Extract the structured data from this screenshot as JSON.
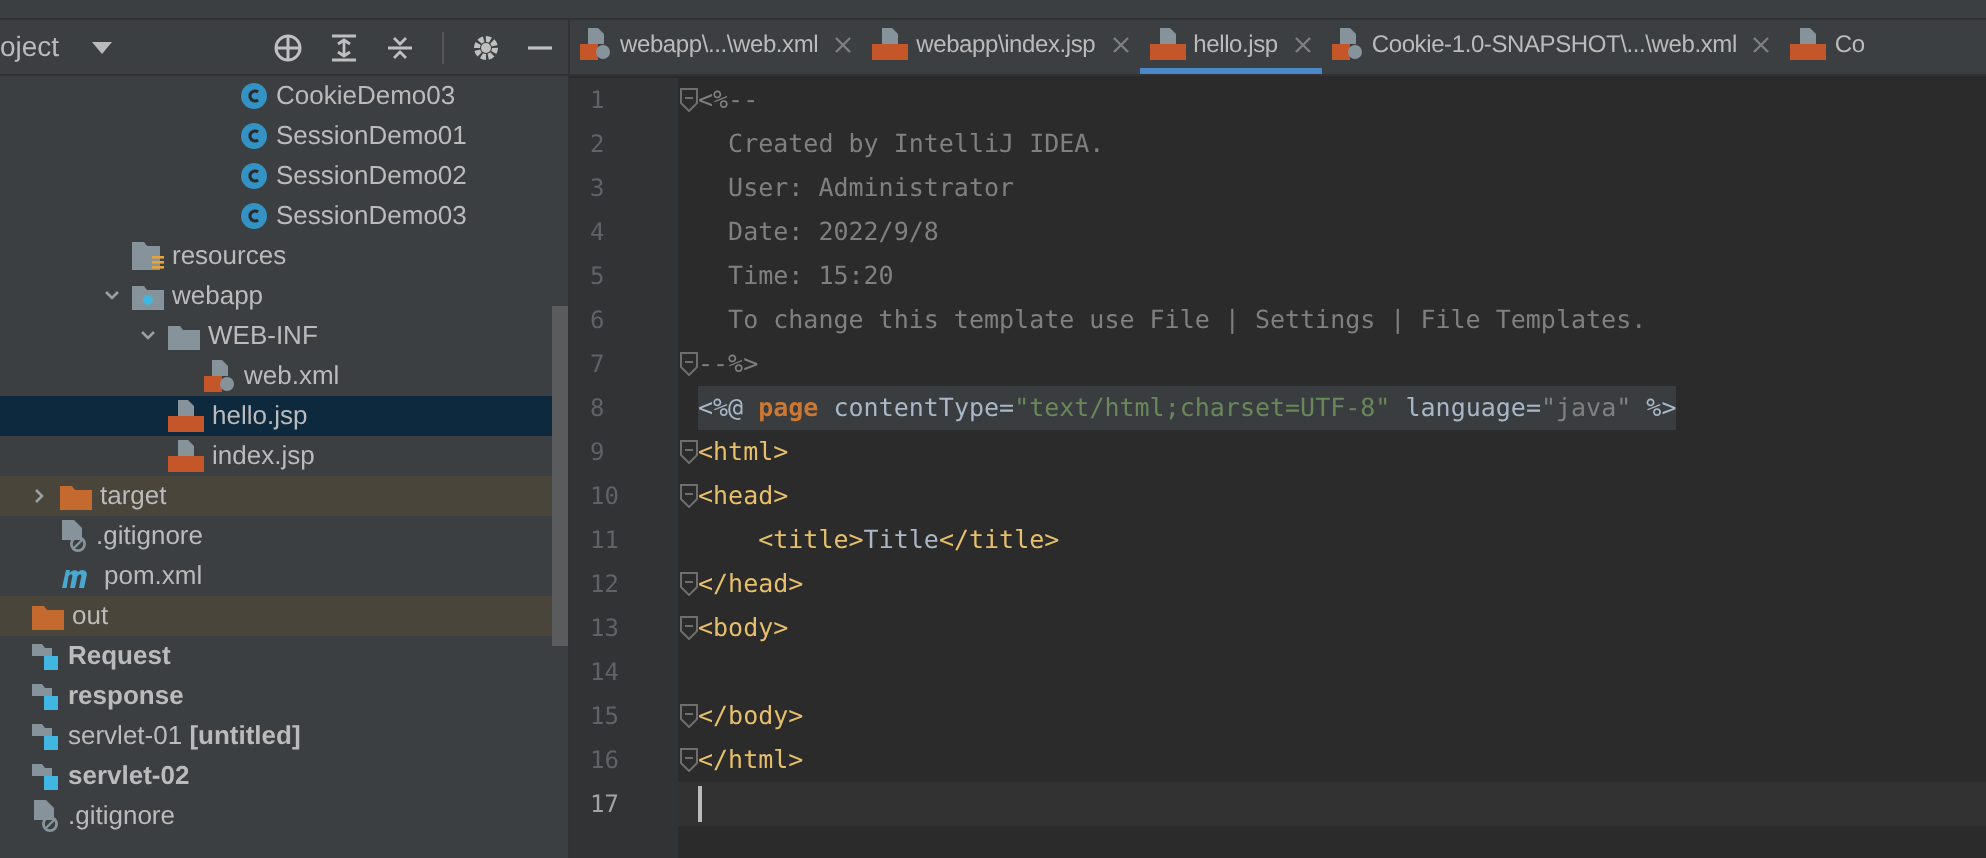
{
  "project_panel": {
    "title": "oject",
    "tree": [
      [
        {
          "name": "CookieDemo03",
          "kind": "class"
        },
        {
          "name": "SessionDemo01",
          "kind": "class"
        },
        {
          "name": "SessionDemo02",
          "kind": "class"
        },
        {
          "name": "SessionDemo03",
          "kind": "class"
        }
      ],
      [
        {
          "name": "resources",
          "kind": "resources-folder"
        },
        {
          "name": "webapp",
          "kind": "web-folder",
          "expanded": true,
          "children": [
            {
              "name": "WEB-INF",
              "kind": "folder",
              "expanded": true,
              "children": [
                {
                  "name": "web.xml",
                  "kind": "xml",
                  "selected": false
                }
              ]
            },
            {
              "name": "hello.jsp",
              "kind": "jsp",
              "selected": true
            },
            {
              "name": "index.jsp",
              "kind": "jsp",
              "selected": false
            }
          ]
        }
      ],
      [
        {
          "name": "target",
          "kind": "excluded-folder",
          "expanded": false
        },
        {
          "name": ".gitignore",
          "kind": "ignore"
        },
        {
          "name": "pom.xml",
          "kind": "maven"
        }
      ],
      [
        {
          "name": "out",
          "kind": "excluded-folder"
        },
        {
          "name": "Request",
          "kind": "module",
          "bold": true
        },
        {
          "name": "response",
          "kind": "module",
          "bold": true
        },
        {
          "name": "servlet-01 **[untitled]**",
          "kind": "module",
          "bold": false
        },
        {
          "name": "servlet-02",
          "kind": "module",
          "bold": true
        },
        {
          "name": ".gitignore",
          "kind": "ignore"
        }
      ]
    ]
  },
  "tabs": [
    {
      "label": "webapp\\...\\web.xml",
      "kind": "xml",
      "selected": false
    },
    {
      "label": "webapp\\index.jsp",
      "kind": "jsp",
      "selected": false
    },
    {
      "label": "hello.jsp",
      "kind": "jsp",
      "selected": true
    },
    {
      "label": "Cookie-1.0-SNAPSHOT\\...\\web.xml",
      "kind": "xml",
      "selected": false
    },
    {
      "label": "Co",
      "kind": "jsp",
      "selected": false
    }
  ],
  "editor": {
    "lines": [
      {
        "number": "1",
        "fold": true,
        "tokens": [
          {
            "text": "<%--",
            "kind": "comment"
          }
        ]
      },
      {
        "number": "2",
        "tokens": [
          {
            "text": "  Created by IntelliJ IDEA.",
            "kind": "comment"
          }
        ]
      },
      {
        "number": "3",
        "tokens": [
          {
            "text": "  User: Administrator",
            "kind": "comment"
          }
        ]
      },
      {
        "number": "4",
        "tokens": [
          {
            "text": "  Date: 2022/9/8",
            "kind": "comment"
          }
        ]
      },
      {
        "number": "5",
        "tokens": [
          {
            "text": "  Time: 15:20",
            "kind": "comment"
          }
        ]
      },
      {
        "number": "6",
        "tokens": [
          {
            "text": "  To change this template use File | Settings | File Templates.",
            "kind": "comment"
          }
        ]
      },
      {
        "number": "7",
        "fold": true,
        "tokens": [
          {
            "text": "--%>",
            "kind": "comment"
          }
        ]
      },
      {
        "number": "8",
        "highlighted": true,
        "tokens": [
          {
            "text": "<%@",
            "kind": "plain"
          },
          {
            "text": " page",
            "kind": "keyword"
          },
          {
            "text": " contentType=",
            "kind": "plain"
          },
          {
            "text": "\"text/html;charset=UTF-8\"",
            "kind": "string"
          },
          {
            "text": " language=",
            "kind": "plain"
          },
          {
            "text": "\"java\"",
            "kind": "muted"
          },
          {
            "text": " %>",
            "kind": "plain"
          }
        ]
      },
      {
        "number": "9",
        "fold": true,
        "tokens": [
          {
            "text": "<html>",
            "kind": "tag"
          }
        ]
      },
      {
        "number": "10",
        "fold": true,
        "tokens": [
          {
            "text": "<head>",
            "kind": "tag"
          }
        ]
      },
      {
        "number": "11",
        "tokens": [
          {
            "text": "    <title>",
            "kind": "tag"
          },
          {
            "text": "Title",
            "kind": "plain"
          },
          {
            "text": "</title>",
            "kind": "tag"
          }
        ]
      },
      {
        "number": "12",
        "fold": true,
        "tokens": [
          {
            "text": "</head>",
            "kind": "tag"
          }
        ]
      },
      {
        "number": "13",
        "fold": true,
        "tokens": [
          {
            "text": "<body>",
            "kind": "tag"
          }
        ]
      },
      {
        "number": "14"
      },
      {
        "number": "15",
        "fold": true,
        "tokens": [
          {
            "text": "</body>",
            "kind": "tag"
          }
        ]
      },
      {
        "number": "16",
        "fold": true,
        "tokens": [
          {
            "text": "</html>",
            "kind": "tag"
          }
        ]
      },
      {
        "number": "17",
        "current": true
      }
    ]
  }
}
